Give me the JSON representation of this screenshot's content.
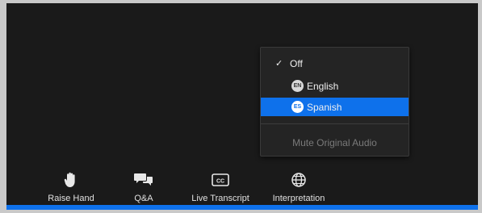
{
  "toolbar": {
    "raise_hand": "Raise Hand",
    "qa": "Q&A",
    "live_transcript": "Live Transcript",
    "interpretation": "Interpretation",
    "cc_glyph": "CC"
  },
  "interpretation_menu": {
    "off_check": "✓",
    "off_label": "Off",
    "english": {
      "badge": "EN",
      "label": "English"
    },
    "spanish": {
      "badge": "ES",
      "label": "Spanish",
      "selected": true
    },
    "mute_original": "Mute Original Audio"
  },
  "colors": {
    "accent": "#0e71eb",
    "background": "#1a1a1a",
    "menu": "#242424"
  },
  "icons": [
    "raise-hand-icon",
    "qa-icon",
    "closed-caption-icon",
    "globe-icon",
    "checkmark-icon"
  ]
}
